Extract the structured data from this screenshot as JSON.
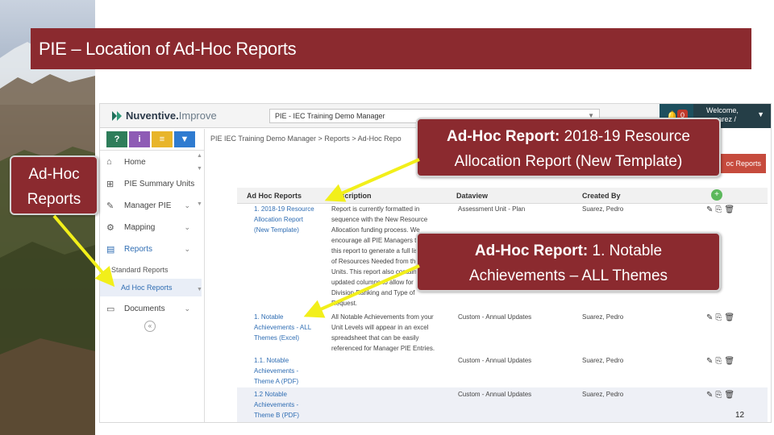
{
  "slide": {
    "title": "PIE – Location of Ad-Hoc Reports",
    "page_number": "12"
  },
  "app": {
    "logo_bold": "Nuventive.",
    "logo_light": "Improve",
    "context_select": "PIE - IEC Training Demo Manager",
    "notif_count": "0",
    "user_welcome": "Welcome,",
    "user_name": "pcuarez /",
    "breadcrumb": "PIE  IEC Training Demo Manager  >  Reports  >  Ad-Hoc Repo",
    "adhoc_button": "oc Reports"
  },
  "sidebar": {
    "tool_labels": [
      "?",
      "i",
      "≡",
      "▼"
    ],
    "items": [
      {
        "label": "Home",
        "icon": "home-icon"
      },
      {
        "label": "PIE Summary Units",
        "icon": "sitemap-icon"
      },
      {
        "label": "Manager PIE",
        "icon": "pencil-icon"
      },
      {
        "label": "Mapping",
        "icon": "mapping-icon"
      },
      {
        "label": "Reports",
        "icon": "reports-icon"
      },
      {
        "label": "Documents",
        "icon": "folder-icon"
      }
    ],
    "subitems": [
      "Standard Reports",
      "Ad Hoc Reports"
    ]
  },
  "table": {
    "headers": [
      "Ad Hoc Reports",
      "Description",
      "Dataview",
      "Created By"
    ],
    "rows": [
      {
        "name": [
          "1. 2018-19 Resource",
          "Allocation Report",
          "(New Template)"
        ],
        "desc": [
          "Report is currently formatted in",
          "sequence with the New Resource",
          "Allocation funding process. We",
          "encourage all PIE Managers to run",
          "this report to generate a full listing",
          "of Resources Needed from their",
          "Units. This report also contains",
          "updated columns to allow for",
          "Division Ranking and Type of",
          "Request."
        ],
        "dataview": "Assessment Unit - Plan",
        "created_by": "Suarez, Pedro"
      },
      {
        "name": [
          "1. Notable",
          "Achievements - ALL",
          "Themes (Excel)"
        ],
        "desc": [
          "All Notable Achievements from your",
          "Unit Levels will appear in an excel",
          "spreadsheet that can be easily",
          "referenced for Manager PIE Entries."
        ],
        "dataview": "Custom - Annual Updates",
        "created_by": "Suarez, Pedro"
      },
      {
        "name": [
          "1.1. Notable",
          "Achievements -",
          "Theme A (PDF)"
        ],
        "desc": [],
        "dataview": "Custom - Annual Updates",
        "created_by": "Suarez, Pedro"
      },
      {
        "name": [
          "1.2 Notable",
          "Achievements -",
          "Theme B (PDF)"
        ],
        "desc": [],
        "dataview": "Custom - Annual Updates",
        "created_by": "Suarez, Pedro"
      }
    ]
  },
  "callouts": {
    "left": [
      "Ad-Hoc",
      "Reports"
    ],
    "top_bold": "Ad-Hoc Report:",
    "top_rest": " 2018-19 Resource",
    "top_line2": "Allocation Report (New Template)",
    "mid_bold": "Ad-Hoc Report:",
    "mid_rest": " 1. Notable",
    "mid_line2": "Achievements – ALL Themes"
  },
  "colors": {
    "title_bar": "#8b2a2f",
    "callout": "#8b2a2f",
    "arrow": "#f2ef1a",
    "link": "#2f6db3",
    "header_dark": "#253e47"
  }
}
